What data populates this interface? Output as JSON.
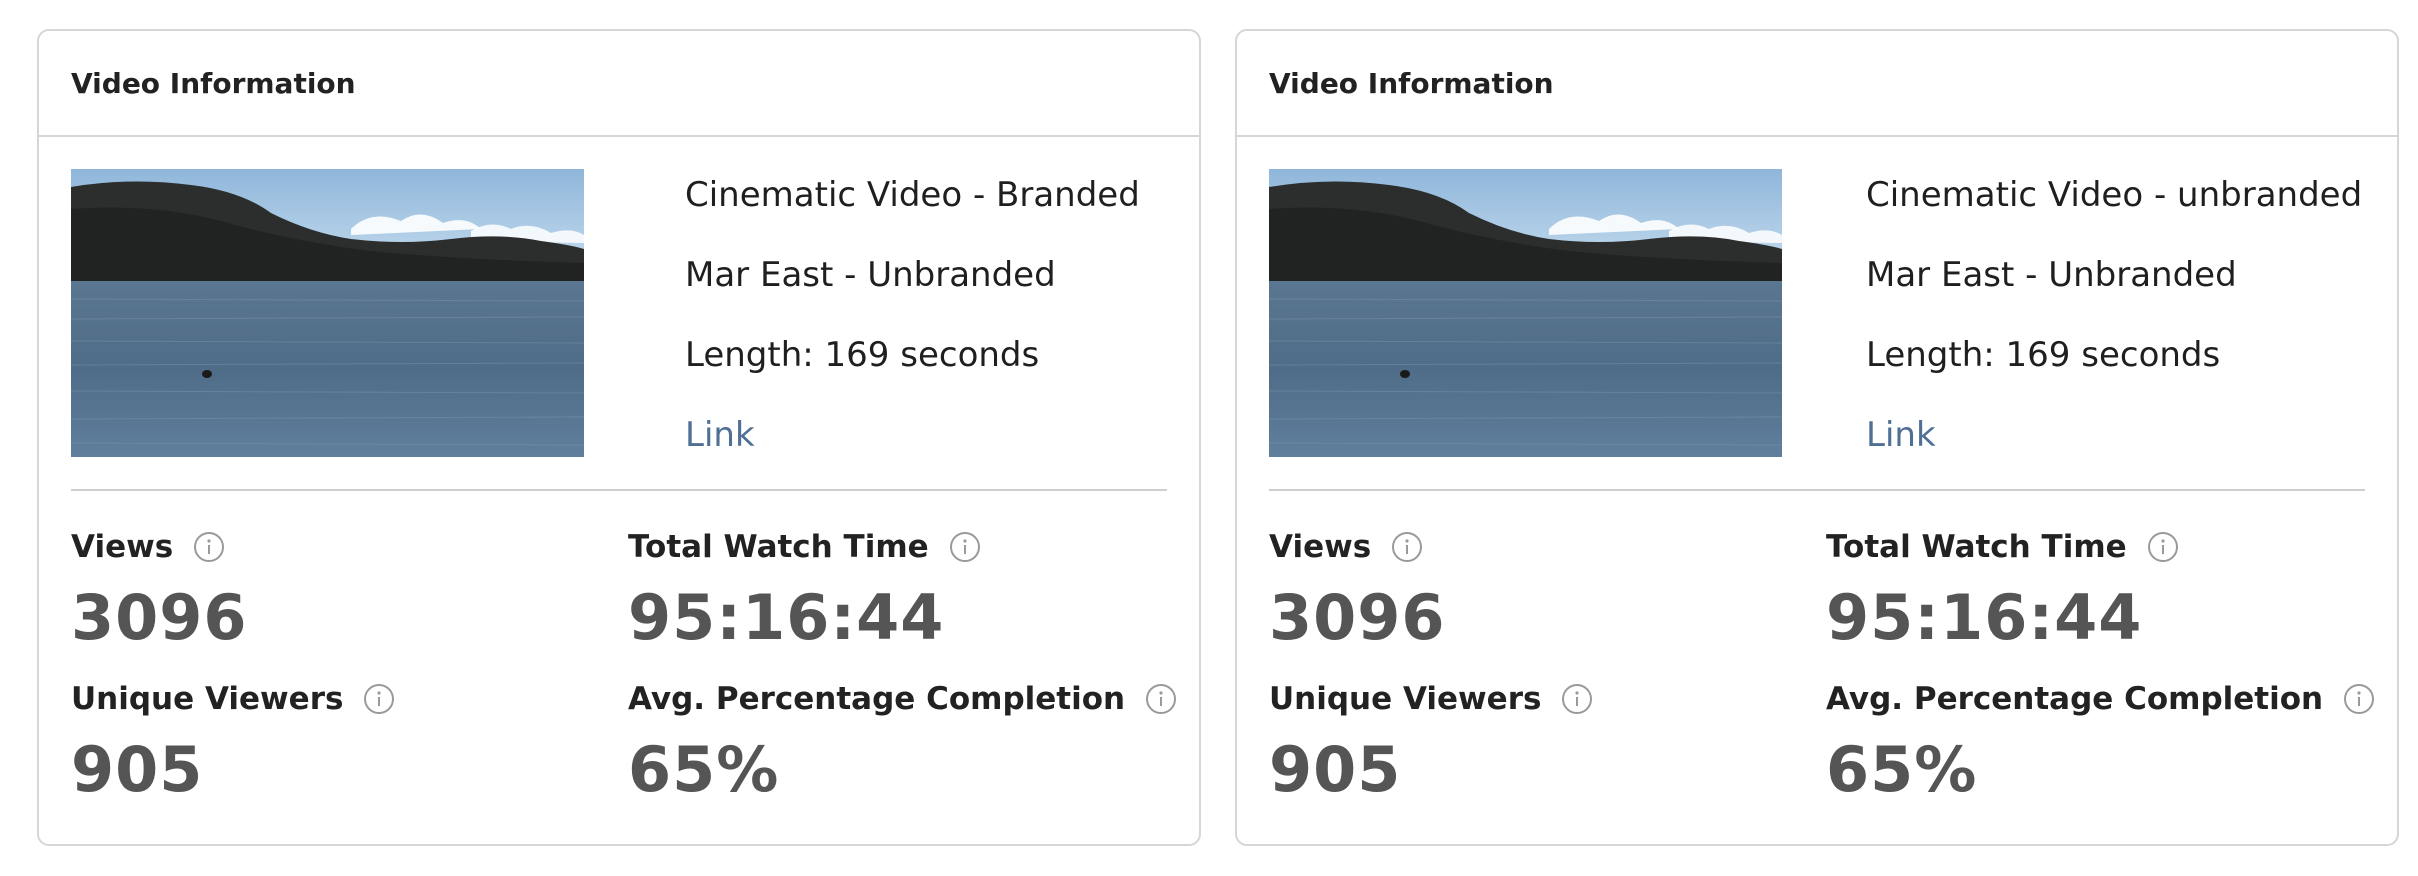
{
  "cards": [
    {
      "title": "Video Information",
      "video_title": "Cinematic Video - Branded",
      "location": "Mar East - Unbranded",
      "length": "Length: 169 seconds",
      "link_label": "Link",
      "stats": {
        "views_label": "Views",
        "views_value": "3096",
        "watch_time_label": "Total Watch Time",
        "watch_time_value": "95:16:44",
        "unique_viewers_label": "Unique Viewers",
        "unique_viewers_value": "905",
        "completion_label": "Avg. Percentage Completion",
        "completion_value": "65%"
      }
    },
    {
      "title": "Video Information",
      "video_title": "Cinematic Video - unbranded",
      "location": "Mar East - Unbranded",
      "length": "Length: 169 seconds",
      "link_label": "Link",
      "stats": {
        "views_label": "Views",
        "views_value": "3096",
        "watch_time_label": "Total Watch Time",
        "watch_time_value": "95:16:44",
        "unique_viewers_label": "Unique Viewers",
        "unique_viewers_value": "905",
        "completion_label": "Avg. Percentage Completion",
        "completion_value": "65%"
      }
    }
  ],
  "icons": {
    "info": "info-circle-icon",
    "thumbnail": "lake-landscape-thumbnail"
  },
  "colors": {
    "link": "#4f6f95",
    "value": "#555555",
    "border": "#d6d6d6"
  }
}
